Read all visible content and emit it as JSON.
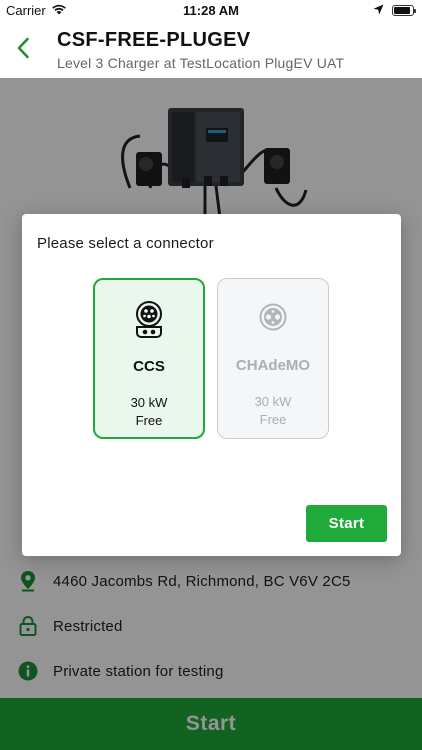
{
  "status_bar": {
    "carrier": "Carrier",
    "time": "11:28 AM",
    "battery_level": 0.9
  },
  "header": {
    "title": "CSF-FREE-PLUGEV",
    "subtitle": "Level 3 Charger at TestLocation PlugEV UAT",
    "back_icon": "chevron-left-icon"
  },
  "station": {
    "address": "4460 Jacombs Rd, Richmond, BC V6V 2C5",
    "access": "Restricted",
    "description": "Private station for testing",
    "start_label": "Start"
  },
  "modal": {
    "title": "Please select a connector",
    "connectors": [
      {
        "name": "CCS",
        "power": "30 kW",
        "price": "Free",
        "state": "selected",
        "icon": "ccs-connector-icon"
      },
      {
        "name": "CHAdeMO",
        "power": "30 kW",
        "price": "Free",
        "state": "disabled",
        "icon": "chademo-connector-icon"
      }
    ],
    "start_label": "Start"
  },
  "colors": {
    "brand_green": "#1faa3a",
    "icon_green": "#1e8f34",
    "selected_border": "#23a63b",
    "selected_bg": "#e9f7ec",
    "disabled_text": "#a9afb6",
    "overlay": "rgba(0,0,0,0.42)"
  }
}
